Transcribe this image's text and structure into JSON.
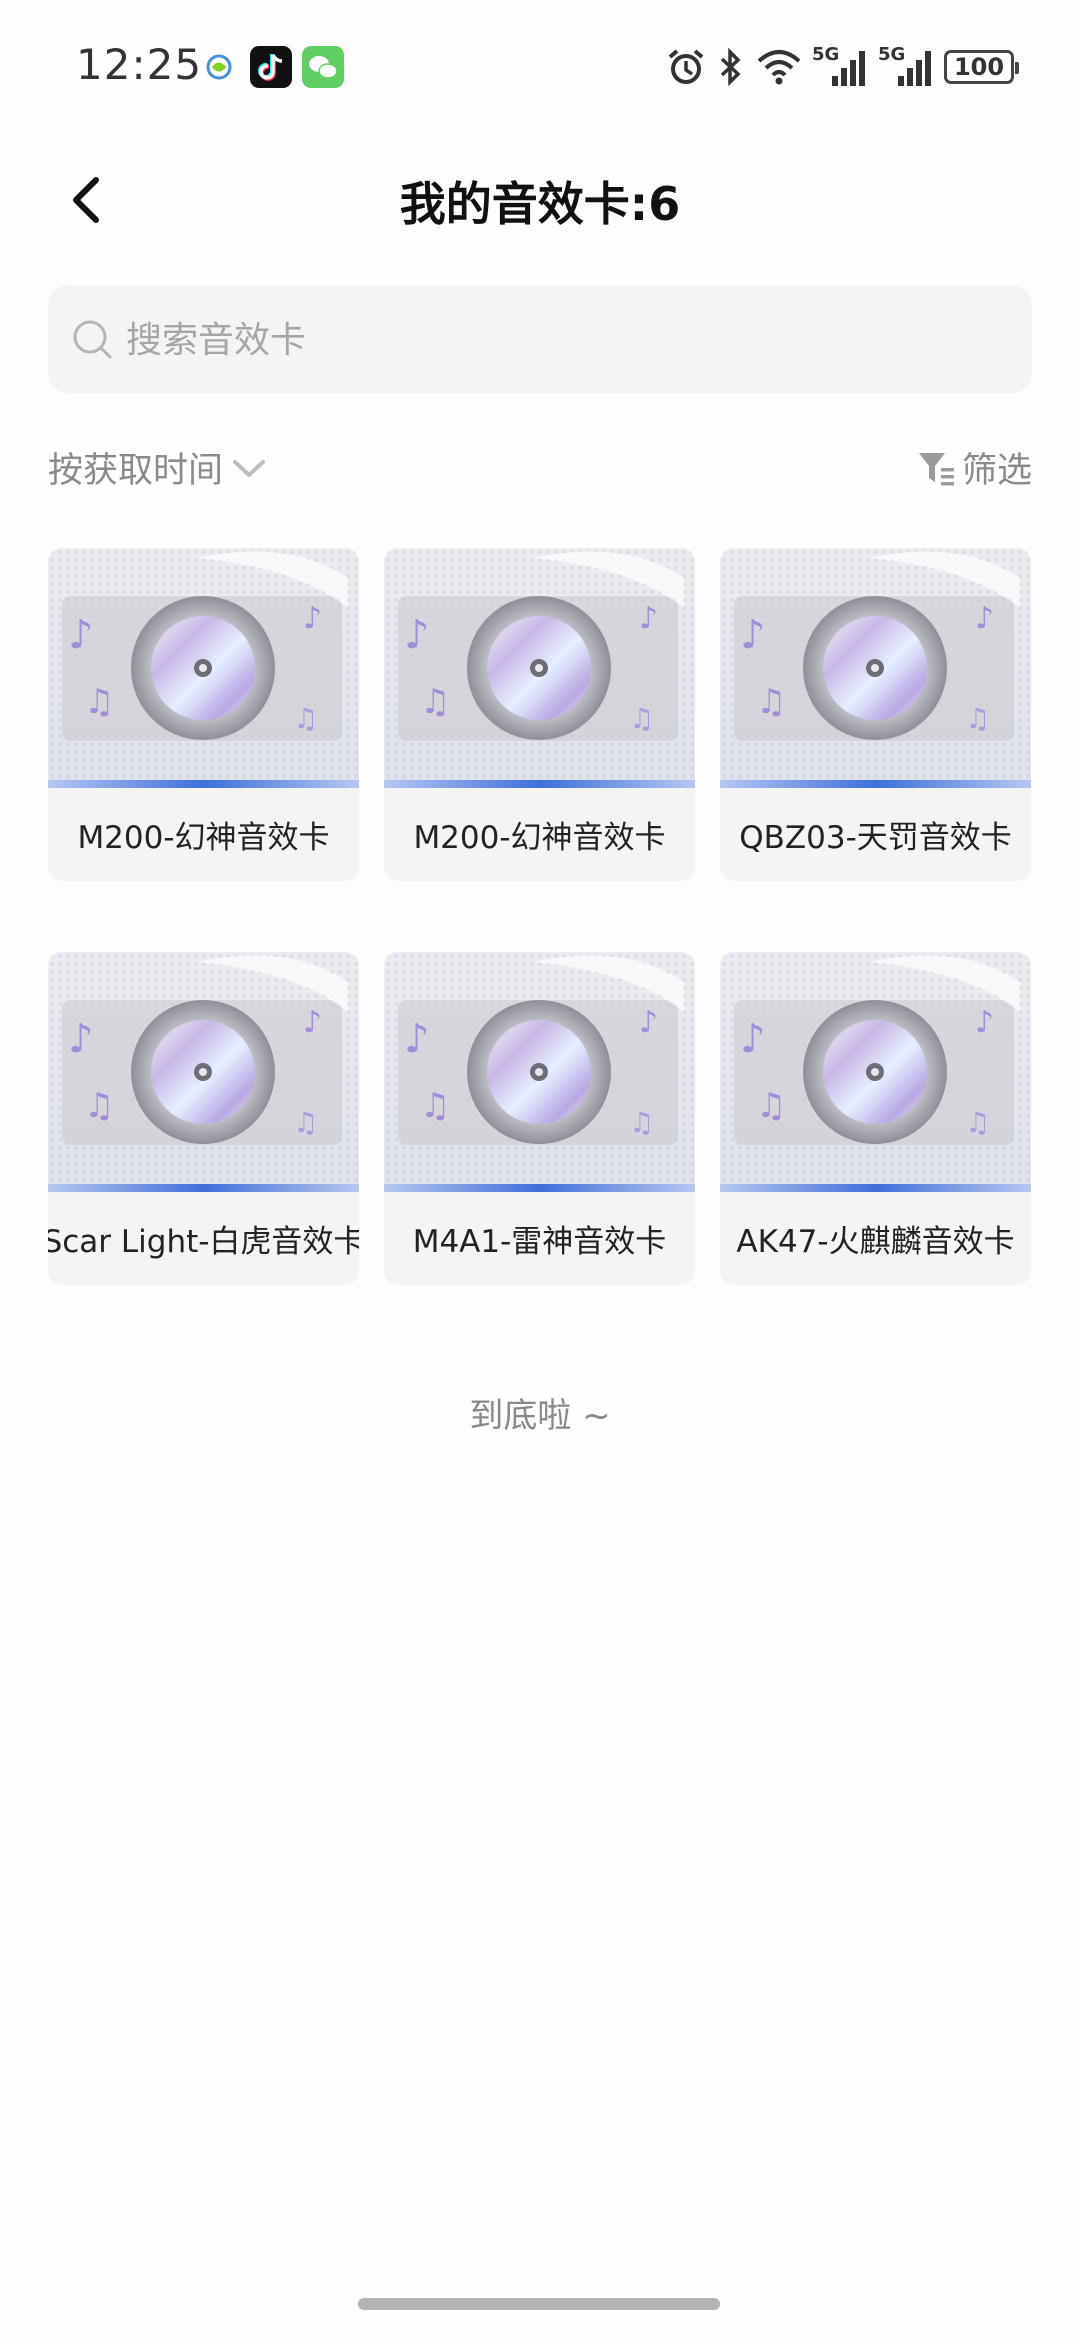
{
  "status_bar": {
    "time": "12:25",
    "battery": "100",
    "network_labels": [
      "5G",
      "5G"
    ],
    "app_icons": [
      "china-mobile-icon",
      "douyin-icon",
      "wechat-icon"
    ],
    "system_icons": [
      "alarm-icon",
      "bluetooth-icon",
      "wifi-icon",
      "signal-5g-icon",
      "signal-5g-icon",
      "battery-icon"
    ]
  },
  "header": {
    "title": "我的音效卡:6",
    "back_icon": "chevron-left-icon"
  },
  "search": {
    "placeholder": "搜索音效卡",
    "value": ""
  },
  "toolbar": {
    "sort_label": "按获取时间",
    "sort_icon": "chevron-down-icon",
    "filter_label": "筛选",
    "filter_icon": "filter-icon"
  },
  "cards": [
    {
      "label": "M200-幻神音效卡"
    },
    {
      "label": "M200-幻神音效卡"
    },
    {
      "label": "QBZ03-天罚音效卡"
    },
    {
      "label": "Scar Light-白虎音效卡"
    },
    {
      "label": "M4A1-雷神音效卡"
    },
    {
      "label": "AK47-火麒麟音效卡"
    }
  ],
  "footer": {
    "end_text": "到底啦 ~"
  },
  "colors": {
    "accent_blue": "#3f6fdb",
    "muted_text": "#8a8a8a",
    "card_bg": "#f4f4f5"
  }
}
